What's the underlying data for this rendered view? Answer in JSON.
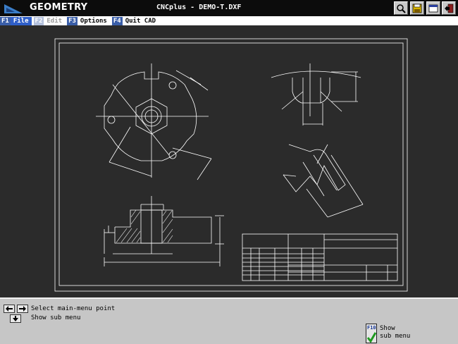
{
  "titlebar": {
    "app_name": "GEOMETRY",
    "file_title": "CNCplus - DEMO-T.DXF",
    "buttons": [
      "magnifier-icon",
      "disk-icon",
      "window-icon",
      "exit-icon"
    ]
  },
  "menu": {
    "items": [
      {
        "key": "F1",
        "label": "File",
        "state": "active"
      },
      {
        "key": "F2",
        "label": "Edit",
        "state": "disabled"
      },
      {
        "key": "F3",
        "label": "Options",
        "state": "normal"
      },
      {
        "key": "F4",
        "label": "Quit CAD",
        "state": "normal"
      }
    ]
  },
  "status": {
    "hint_main": "Select main-menu point",
    "hint_sub": "Show sub menu",
    "f10_key": "F10",
    "f10_label_1": "Show",
    "f10_label_2": "sub menu"
  },
  "colors": {
    "canvas": "#2b2b2b",
    "drawing": "#ffffff",
    "menu_active": "#2f5fc9",
    "fkey": "#3a5ea8",
    "status": "#c6c6c6"
  }
}
